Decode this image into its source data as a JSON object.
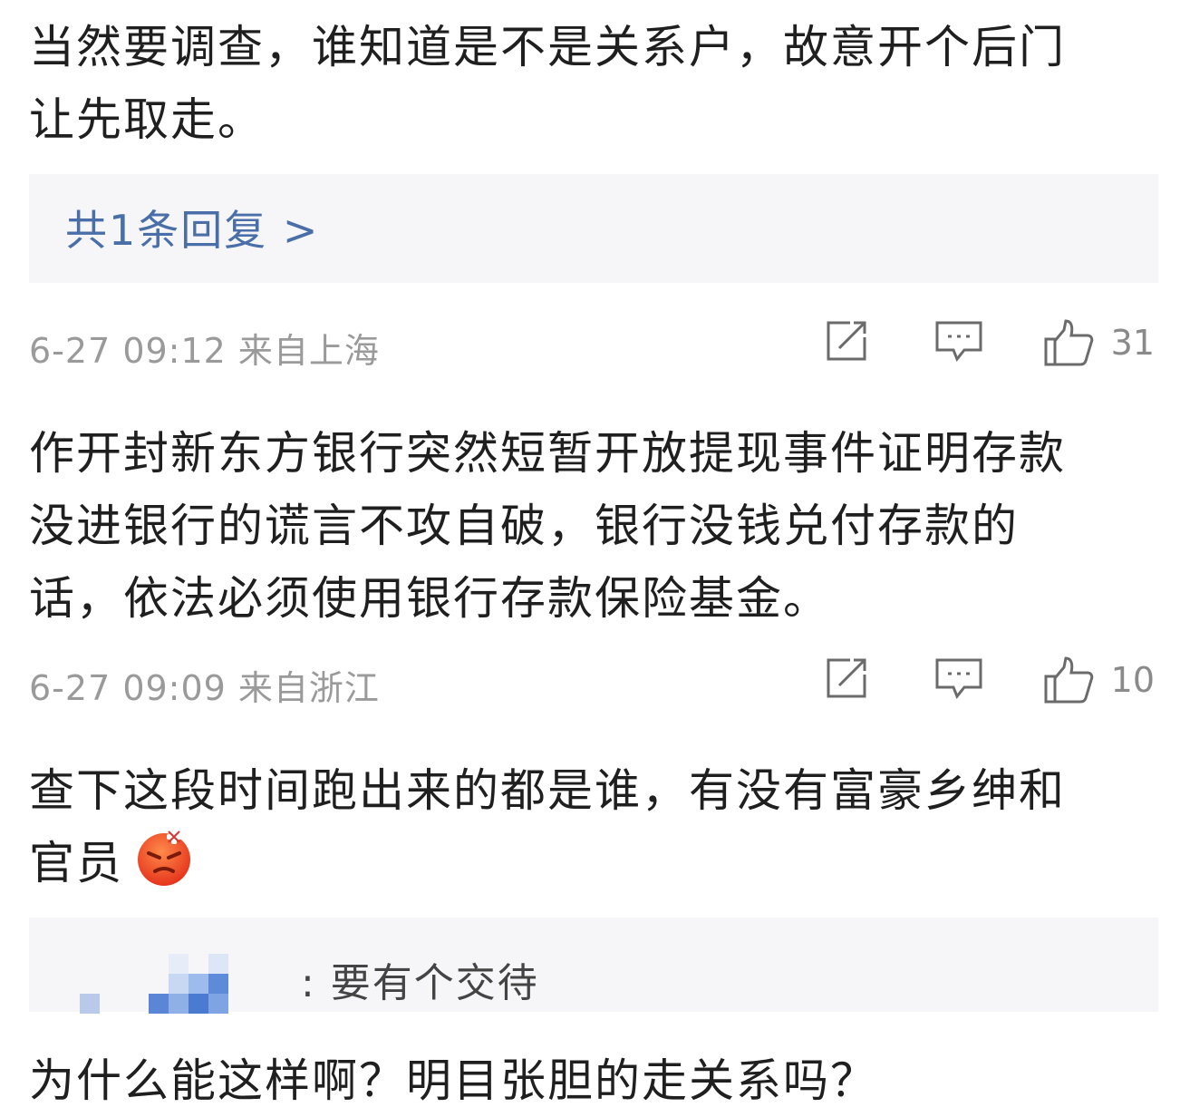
{
  "comments": [
    {
      "text_line1": "当然要调查，谁知道是不是关系户，故意开个后门",
      "text_line2": "让先取走。",
      "replies_link": "共1条回复 >",
      "meta": "6-27 09:12 来自上海",
      "likes": "31"
    },
    {
      "text_line1": "作开封新东方银行突然短暂开放提现事件证明存款",
      "text_line2": "没进银行的谎言不攻自破，银行没钱兑付存款的",
      "text_line3": "话，依法必须使用银行存款保险基金。",
      "meta": "6-27 09:09 来自浙江",
      "likes": "10"
    },
    {
      "text_line1": "查下这段时间跑出来的都是谁，有没有富豪乡绅和",
      "text_line2": "官员",
      "emoji": "angry-face-icon",
      "reply_preview": ": 要有个交待"
    },
    {
      "text_line1": "为什么能这样啊？明目张胆的走关系吗？"
    }
  ],
  "colors": {
    "link": "#4a6fa8",
    "meta": "#9a9a9a",
    "reply_bg": "#f6f6f8"
  }
}
